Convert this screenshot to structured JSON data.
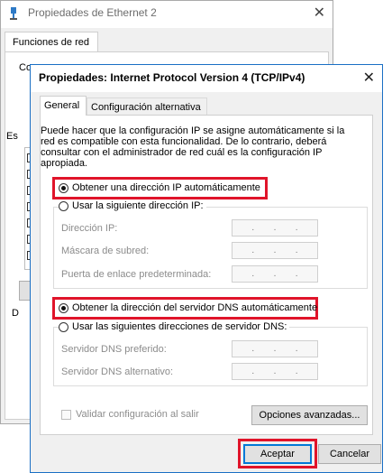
{
  "background_window": {
    "title": "Propiedades de Ethernet 2",
    "tab_label": "Funciones de red",
    "fragments": [
      "Co",
      "Es",
      "D"
    ]
  },
  "dialog": {
    "title": "Propiedades: Internet Protocol Version 4 (TCP/IPv4)",
    "close_glyph": "✕",
    "tabs": [
      {
        "label": "General",
        "selected": true
      },
      {
        "label": "Configuración alternativa",
        "selected": false
      }
    ],
    "intro": "Puede hacer que la configuración IP se asigne automáticamente si la red es compatible con esta funcionalidad. De lo contrario, deberá consultar con el administrador de red cuál es la configuración IP apropiada.",
    "ip": {
      "auto_label": "Obtener una dirección IP automáticamente",
      "auto_selected": true,
      "manual_label": "Usar la siguiente dirección IP:",
      "fields": [
        {
          "label": "Dirección IP:",
          "value": ". . ."
        },
        {
          "label": "Máscara de subred:",
          "value": ". . ."
        },
        {
          "label": "Puerta de enlace predeterminada:",
          "value": ". . ."
        }
      ]
    },
    "dns": {
      "auto_label": "Obtener la dirección del servidor DNS automáticamente",
      "auto_selected": true,
      "manual_label": "Usar las siguientes direcciones de servidor DNS:",
      "fields": [
        {
          "label": "Servidor DNS preferido:",
          "value": ". . ."
        },
        {
          "label": "Servidor DNS alternativo:",
          "value": ". . ."
        }
      ]
    },
    "validate_label": "Validar configuración al salir",
    "advanced_button": "Opciones avanzadas...",
    "ok_button": "Aceptar",
    "cancel_button": "Cancelar",
    "highlight_color": "#e0142a"
  }
}
